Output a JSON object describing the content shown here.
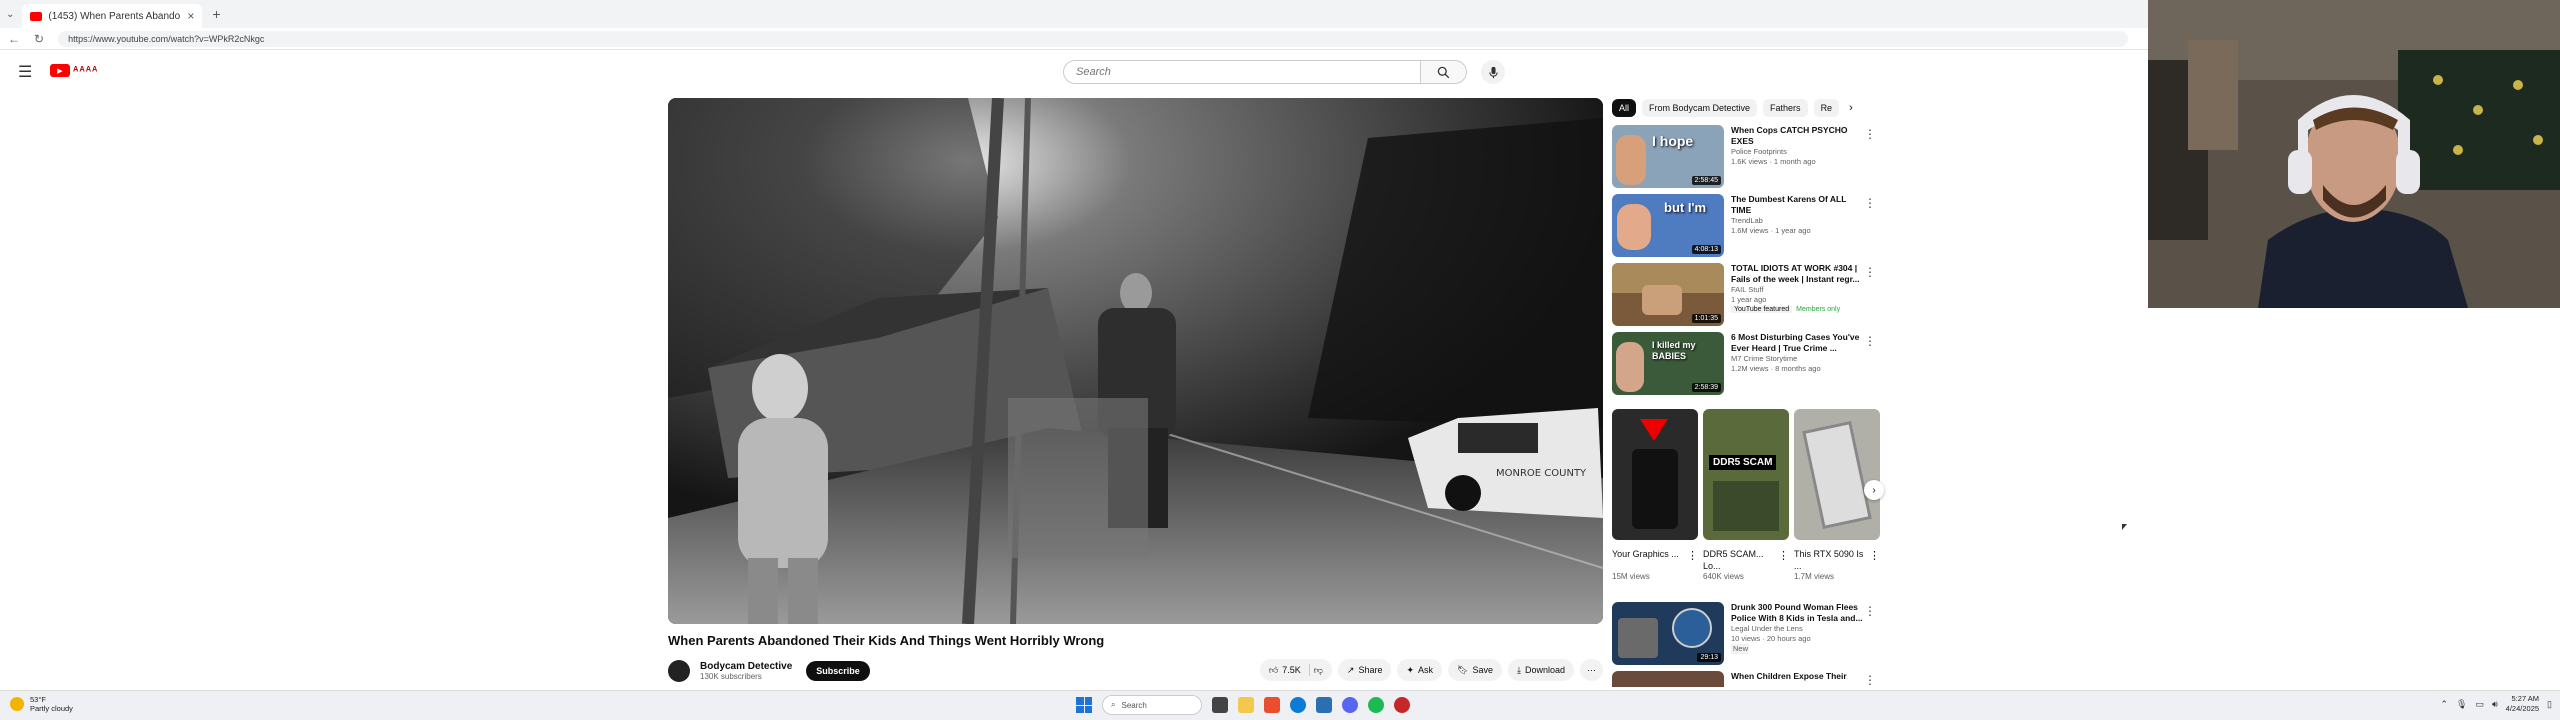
{
  "browser": {
    "tab_title": "(1453) When Parents Abando",
    "url": "https://www.youtube.com/watch?v=WPkR2cNkgc"
  },
  "header": {
    "search_placeholder": "Search"
  },
  "video": {
    "title": "When Parents Abandoned Their Kids And Things Went Horribly Wrong",
    "channel": "Bodycam Detective",
    "subscribers": "130K subscribers",
    "subscribe_label": "Subscribe",
    "likes": "7.5K",
    "share_label": "Share",
    "ask_label": "Ask",
    "save_label": "Save",
    "download_label": "Download",
    "overlay_text": "MONROE COUNTY"
  },
  "chips": [
    "All",
    "From Bodycam Detective",
    "Fathers",
    "Re"
  ],
  "recommendations": [
    {
      "title": "When Cops CATCH PSYCHO EXES",
      "channel": "Police Footprints",
      "meta": "1.6K views · 1 month ago",
      "duration": "2:58:45",
      "thumb_text": "I hope",
      "color": "#8aa3b8"
    },
    {
      "title": "The Dumbest Karens Of ALL TIME",
      "channel": "TrendLab",
      "meta": "1.6M views · 1 year ago",
      "duration": "4:08:13",
      "thumb_text": "but I'm",
      "color": "#4f7bc0"
    },
    {
      "title": "TOTAL IDIOTS AT WORK #304 | Fails of the week | Instant regr...",
      "channel": "FAIL Stuff",
      "meta": "1 year ago",
      "duration": "1:01:35",
      "thumb_text": "",
      "color": "#7a5a3a",
      "badge1": "YouTube featured",
      "badge2": "Members only"
    },
    {
      "title": "6 Most Disturbing Cases You've Ever Heard | True Crime ...",
      "channel": "M7 Crime Storytime",
      "meta": "1.2M views · 8 months ago",
      "duration": "2:58:39",
      "thumb_text": "I killed my BABIES",
      "color": "#3a5a3a"
    }
  ],
  "shorts": [
    {
      "title": "Your Graphics ...",
      "views": "15M views",
      "color": "#2a2a2a"
    },
    {
      "title": "DDR5 SCAM... Lo...",
      "views": "640K views",
      "color": "#5a6a3a",
      "thumb_text": "DDR5 SCAM"
    },
    {
      "title": "This RTX 5090 Is ...",
      "views": "1.7M views",
      "color": "#b0b0a8"
    }
  ],
  "recommendations2": [
    {
      "title": "Drunk 300 Pound Woman Flees Police With 8 Kids in Tesla and...",
      "channel": "Legal Under the Lens",
      "meta": "10 views · 20 hours ago",
      "duration": "29:13",
      "badge": "New",
      "color": "#1f3a5a"
    },
    {
      "title": "When Children Expose Their",
      "color": "#6a4a3a"
    }
  ],
  "taskbar": {
    "weather_temp": "53°F",
    "weather_desc": "Partly cloudy",
    "search_label": "Search",
    "time": "5:27 AM",
    "date": "4/24/2025"
  }
}
